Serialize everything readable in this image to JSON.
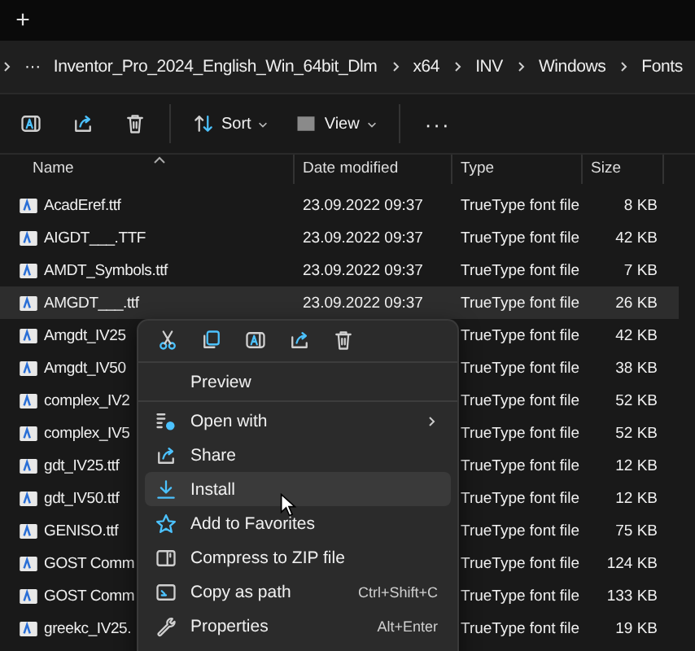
{
  "tab_bar": {
    "new_tab": "+"
  },
  "address_bar": {
    "more": "···",
    "path": [
      "Inventor_Pro_2024_English_Win_64bit_Dlm",
      "x64",
      "INV",
      "Windows",
      "Fonts"
    ]
  },
  "toolbar": {
    "buttons": [
      {
        "kind": "rename"
      },
      {
        "kind": "share"
      },
      {
        "kind": "delete"
      },
      {
        "kind": "sort",
        "label": "Sort"
      },
      {
        "kind": "view",
        "label": "View"
      },
      {
        "kind": "more",
        "label": "···"
      }
    ]
  },
  "columns": [
    {
      "label": "Name",
      "sorted": true
    },
    {
      "label": "Date modified",
      "sorted": false
    },
    {
      "label": "Type",
      "sorted": false
    },
    {
      "label": "Size",
      "sorted": false
    }
  ],
  "rows": [
    {
      "name": "AcadEref.ttf",
      "date": "23.09.2022 09:37",
      "type": "TrueType font file",
      "size": "8 KB",
      "selected": false
    },
    {
      "name": "AIGDT___.TTF",
      "date": "23.09.2022 09:37",
      "type": "TrueType font file",
      "size": "42 KB",
      "selected": false
    },
    {
      "name": "AMDT_Symbols.ttf",
      "date": "23.09.2022 09:37",
      "type": "TrueType font file",
      "size": "7 KB",
      "selected": false
    },
    {
      "name": "AMGDT___.ttf",
      "date": "23.09.2022 09:37",
      "type": "TrueType font file",
      "size": "26 KB",
      "selected": true
    },
    {
      "name": "Amgdt_IV25",
      "type": "TrueType font file",
      "size": "42 KB",
      "selected": false
    },
    {
      "name": "Amgdt_IV50",
      "type": "TrueType font file",
      "size": "38 KB",
      "selected": false
    },
    {
      "name": "complex_IV2",
      "type": "TrueType font file",
      "size": "52 KB",
      "selected": false
    },
    {
      "name": "complex_IV5",
      "type": "TrueType font file",
      "size": "52 KB",
      "selected": false
    },
    {
      "name": "gdt_IV25.ttf",
      "type": "TrueType font file",
      "size": "12 KB",
      "selected": false
    },
    {
      "name": "gdt_IV50.ttf",
      "type": "TrueType font file",
      "size": "12 KB",
      "selected": false
    },
    {
      "name": "GENISO.ttf",
      "type": "TrueType font file",
      "size": "75 KB",
      "selected": false
    },
    {
      "name": "GOST Comm",
      "type": "TrueType font file",
      "size": "124 KB",
      "selected": false
    },
    {
      "name": "GOST Comm",
      "type": "TrueType font file",
      "size": "133 KB",
      "selected": false
    },
    {
      "name": "greekc_IV25.",
      "type": "TrueType font file",
      "size": "19 KB",
      "selected": false
    }
  ],
  "context_menu": {
    "quick_actions": [
      {
        "kind": "cut"
      },
      {
        "kind": "copy"
      },
      {
        "kind": "rename"
      },
      {
        "kind": "share"
      },
      {
        "kind": "delete"
      }
    ],
    "items": [
      {
        "kind": "preview",
        "label": "Preview",
        "hovered": false,
        "divider_before": false
      },
      {
        "kind": "open-with",
        "label": "Open with",
        "hovered": false,
        "divider_before": true,
        "submenu": true
      },
      {
        "kind": "share",
        "label": "Share",
        "hovered": false,
        "divider_before": false
      },
      {
        "kind": "install",
        "label": "Install",
        "hovered": true,
        "divider_before": false
      },
      {
        "kind": "favorite",
        "label": "Add to Favorites",
        "hovered": false,
        "divider_before": false
      },
      {
        "kind": "zip",
        "label": "Compress to ZIP file",
        "hovered": false,
        "divider_before": false
      },
      {
        "kind": "copy-path",
        "label": "Copy as path",
        "hovered": false,
        "divider_before": false,
        "shortcut": "Ctrl+Shift+C"
      },
      {
        "kind": "properties",
        "label": "Properties",
        "hovered": false,
        "divider_before": false,
        "shortcut": "Alt+Enter"
      }
    ]
  }
}
